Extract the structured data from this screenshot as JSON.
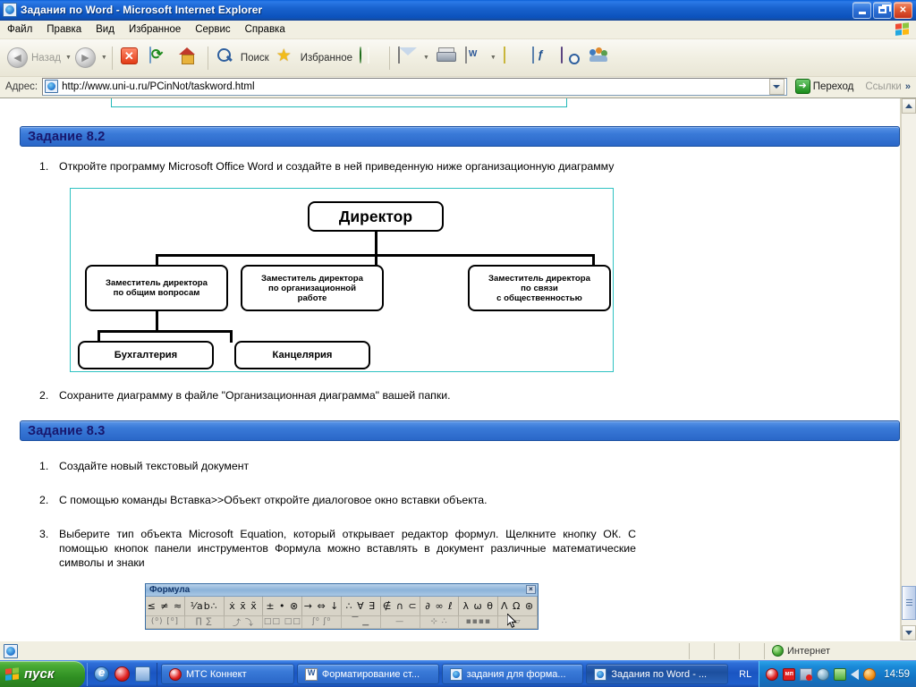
{
  "window": {
    "title": "Задания по Word - Microsoft Internet Explorer",
    "icon": "ie-document-icon",
    "minimize_label": "Свернуть",
    "restore_label": "Восстановить",
    "close_label": "Закрыть"
  },
  "menu": {
    "items": [
      {
        "label": "Файл"
      },
      {
        "label": "Правка"
      },
      {
        "label": "Вид"
      },
      {
        "label": "Избранное"
      },
      {
        "label": "Сервис"
      },
      {
        "label": "Справка"
      }
    ]
  },
  "toolbar": {
    "back_label": "Назад",
    "search_label": "Поиск",
    "favorites_label": "Избранное",
    "buttons": [
      {
        "name": "back-button",
        "icon": "back-arrow-icon"
      },
      {
        "name": "forward-button",
        "icon": "forward-arrow-icon"
      },
      {
        "name": "stop-button",
        "icon": "stop-icon"
      },
      {
        "name": "refresh-button",
        "icon": "refresh-icon"
      },
      {
        "name": "home-button",
        "icon": "home-icon"
      },
      {
        "name": "search-button",
        "icon": "search-icon"
      },
      {
        "name": "favorites-button",
        "icon": "star-icon"
      },
      {
        "name": "history-button",
        "icon": "globe-clock-icon"
      },
      {
        "name": "mail-button",
        "icon": "mail-icon"
      },
      {
        "name": "print-button",
        "icon": "printer-icon"
      },
      {
        "name": "edit-word-button",
        "icon": "word-document-icon"
      },
      {
        "name": "notes-button",
        "icon": "note-icon"
      },
      {
        "name": "messenger-button",
        "icon": "messenger-icon"
      },
      {
        "name": "research-button",
        "icon": "book-search-icon"
      },
      {
        "name": "contacts-button",
        "icon": "people-icon"
      }
    ]
  },
  "address": {
    "label": "Адрес:",
    "url": "http://www.uni-u.ru/PCinNot/taskword.html",
    "go_label": "Переход",
    "links_label": "Ссылки",
    "overflow_glyph": "»"
  },
  "content": {
    "task82": {
      "heading": "Задание 8.2",
      "steps": [
        {
          "num": "1.",
          "text": "Откройте программу Microsoft Office Word и создайте в ней приведенную ниже организационную диаграмму"
        },
        {
          "num": "2.",
          "text": "Сохраните диаграмму в файле \"Организационная диаграмма\" вашей папки."
        }
      ]
    },
    "task83": {
      "heading": "Задание 8.3",
      "steps": [
        {
          "num": "1.",
          "text": "Создайте новый текстовый документ"
        },
        {
          "num": "2.",
          "text": "С помощью команды Вставка>>Объект откройте диалоговое окно вставки объекта."
        },
        {
          "num": "3.",
          "text": "Выберите тип объекта Microsoft Equation, который открывает редактор формул. Щелкните кнопку ОК. С помощью кнопок панели инструментов Формула можно вставлять в документ различные математические символы и знаки"
        }
      ]
    },
    "orgchart": {
      "border_color": "#2fc2c2",
      "root": "Директор",
      "level2": [
        "Заместитель директора\nпо общим вопросам",
        "Заместитель директора\nпо организационной\nработе",
        "Заместитель директора\nпо связи\nс общественностью"
      ],
      "level2_lines": [
        [
          "Заместитель директора",
          "по общим вопросам"
        ],
        [
          "Заместитель директора",
          "по организационной",
          "работе"
        ],
        [
          "Заместитель директора",
          "по связи",
          "с общественностью"
        ]
      ],
      "level3": [
        "Бухгалтерия",
        "Канцелярия"
      ]
    },
    "formula_toolbar": {
      "title": "Формула",
      "close_glyph": "×",
      "row1": [
        "≤ ≠ ≈",
        "⅟ab∴",
        "ẋ x̄ x̃",
        "± • ⊗",
        "→ ⇔ ↓",
        "∴ ∀ ∃",
        "∉ ∩ ⊂",
        "∂ ∞ ℓ",
        "λ ω θ",
        "Λ Ω ⊛"
      ],
      "row2": [
        "(⁰) [⁰]",
        "∏ ∑",
        "⤴ ⤵",
        "□□ □□",
        "ʃ⁰ ʃ⁰",
        "▔ ▁",
        "—",
        "⊹ ∴",
        "▪▪▪▪",
        "▱"
      ]
    }
  },
  "scrollbar": {
    "up_label": "Прокрутить вверх",
    "down_label": "Прокрутить вниз"
  },
  "statusbar": {
    "zone": "Интернет",
    "zone_icon": "globe-icon"
  },
  "taskbar": {
    "start_label": "пуск",
    "quicklaunch": [
      {
        "name": "quicklaunch-ie",
        "icon": "ie-icon"
      },
      {
        "name": "quicklaunch-opera",
        "icon": "opera-icon"
      },
      {
        "name": "quicklaunch-show-desktop",
        "icon": "show-desktop-icon"
      }
    ],
    "tasks": [
      {
        "label": "МТС Коннект",
        "icon": "opera-icon",
        "active": false
      },
      {
        "label": "Форматирование ст...",
        "icon": "word-icon",
        "active": false
      },
      {
        "label": "задания для форма...",
        "icon": "ie-icon",
        "active": false
      },
      {
        "label": "Задания по Word - ...",
        "icon": "ie-icon",
        "active": true
      }
    ],
    "language": "RL",
    "tray_icons": [
      {
        "name": "tray-opera-icon"
      },
      {
        "name": "tray-mts-icon",
        "text": "мп"
      },
      {
        "name": "tray-network-icon"
      },
      {
        "name": "tray-shield-icon"
      },
      {
        "name": "tray-speaker-device-icon"
      },
      {
        "name": "tray-volume-icon"
      },
      {
        "name": "tray-update-icon"
      }
    ],
    "clock": "14:59"
  }
}
